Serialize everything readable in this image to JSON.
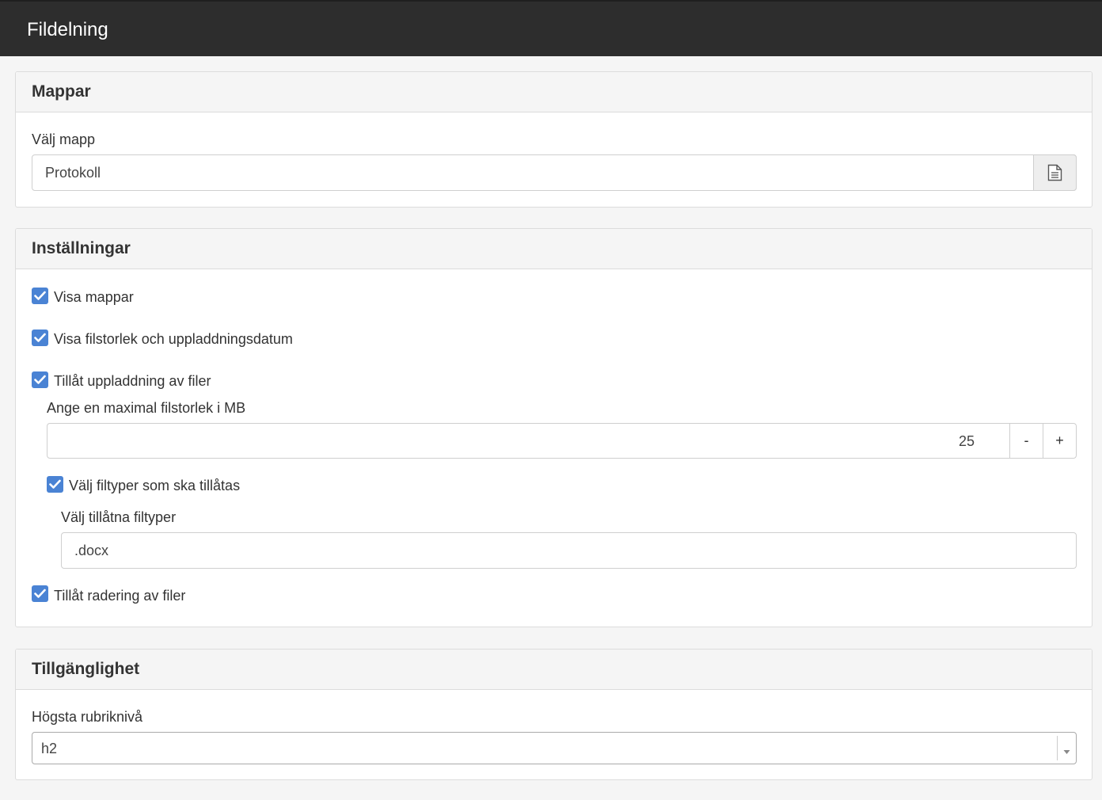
{
  "app": {
    "title": "Fildelning"
  },
  "folders": {
    "heading": "Mappar",
    "select_label": "Välj mapp",
    "value": "Protokoll",
    "browse_icon": "document-icon"
  },
  "settings": {
    "heading": "Inställningar",
    "show_folders": {
      "label": "Visa mappar",
      "checked": true
    },
    "show_size_date": {
      "label": "Visa filstorlek och uppladdningsdatum",
      "checked": true
    },
    "allow_upload": {
      "label": "Tillåt uppladdning av filer",
      "checked": true
    },
    "max_size_label": "Ange en maximal filstorlek i MB",
    "max_size_value": "25",
    "minus_label": "-",
    "plus_label": "+",
    "choose_types": {
      "label": "Välj filtyper som ska tillåtas",
      "checked": true
    },
    "types_label": "Välj tillåtna filtyper",
    "types_value": ".docx",
    "allow_delete": {
      "label": "Tillåt radering av filer",
      "checked": true
    }
  },
  "accessibility": {
    "heading": "Tillgänglighet",
    "heading_level_label": "Högsta rubriknivå",
    "heading_level_value": "h2"
  },
  "colors": {
    "accent": "#4a83d4",
    "topbar": "#2d2d2d"
  }
}
